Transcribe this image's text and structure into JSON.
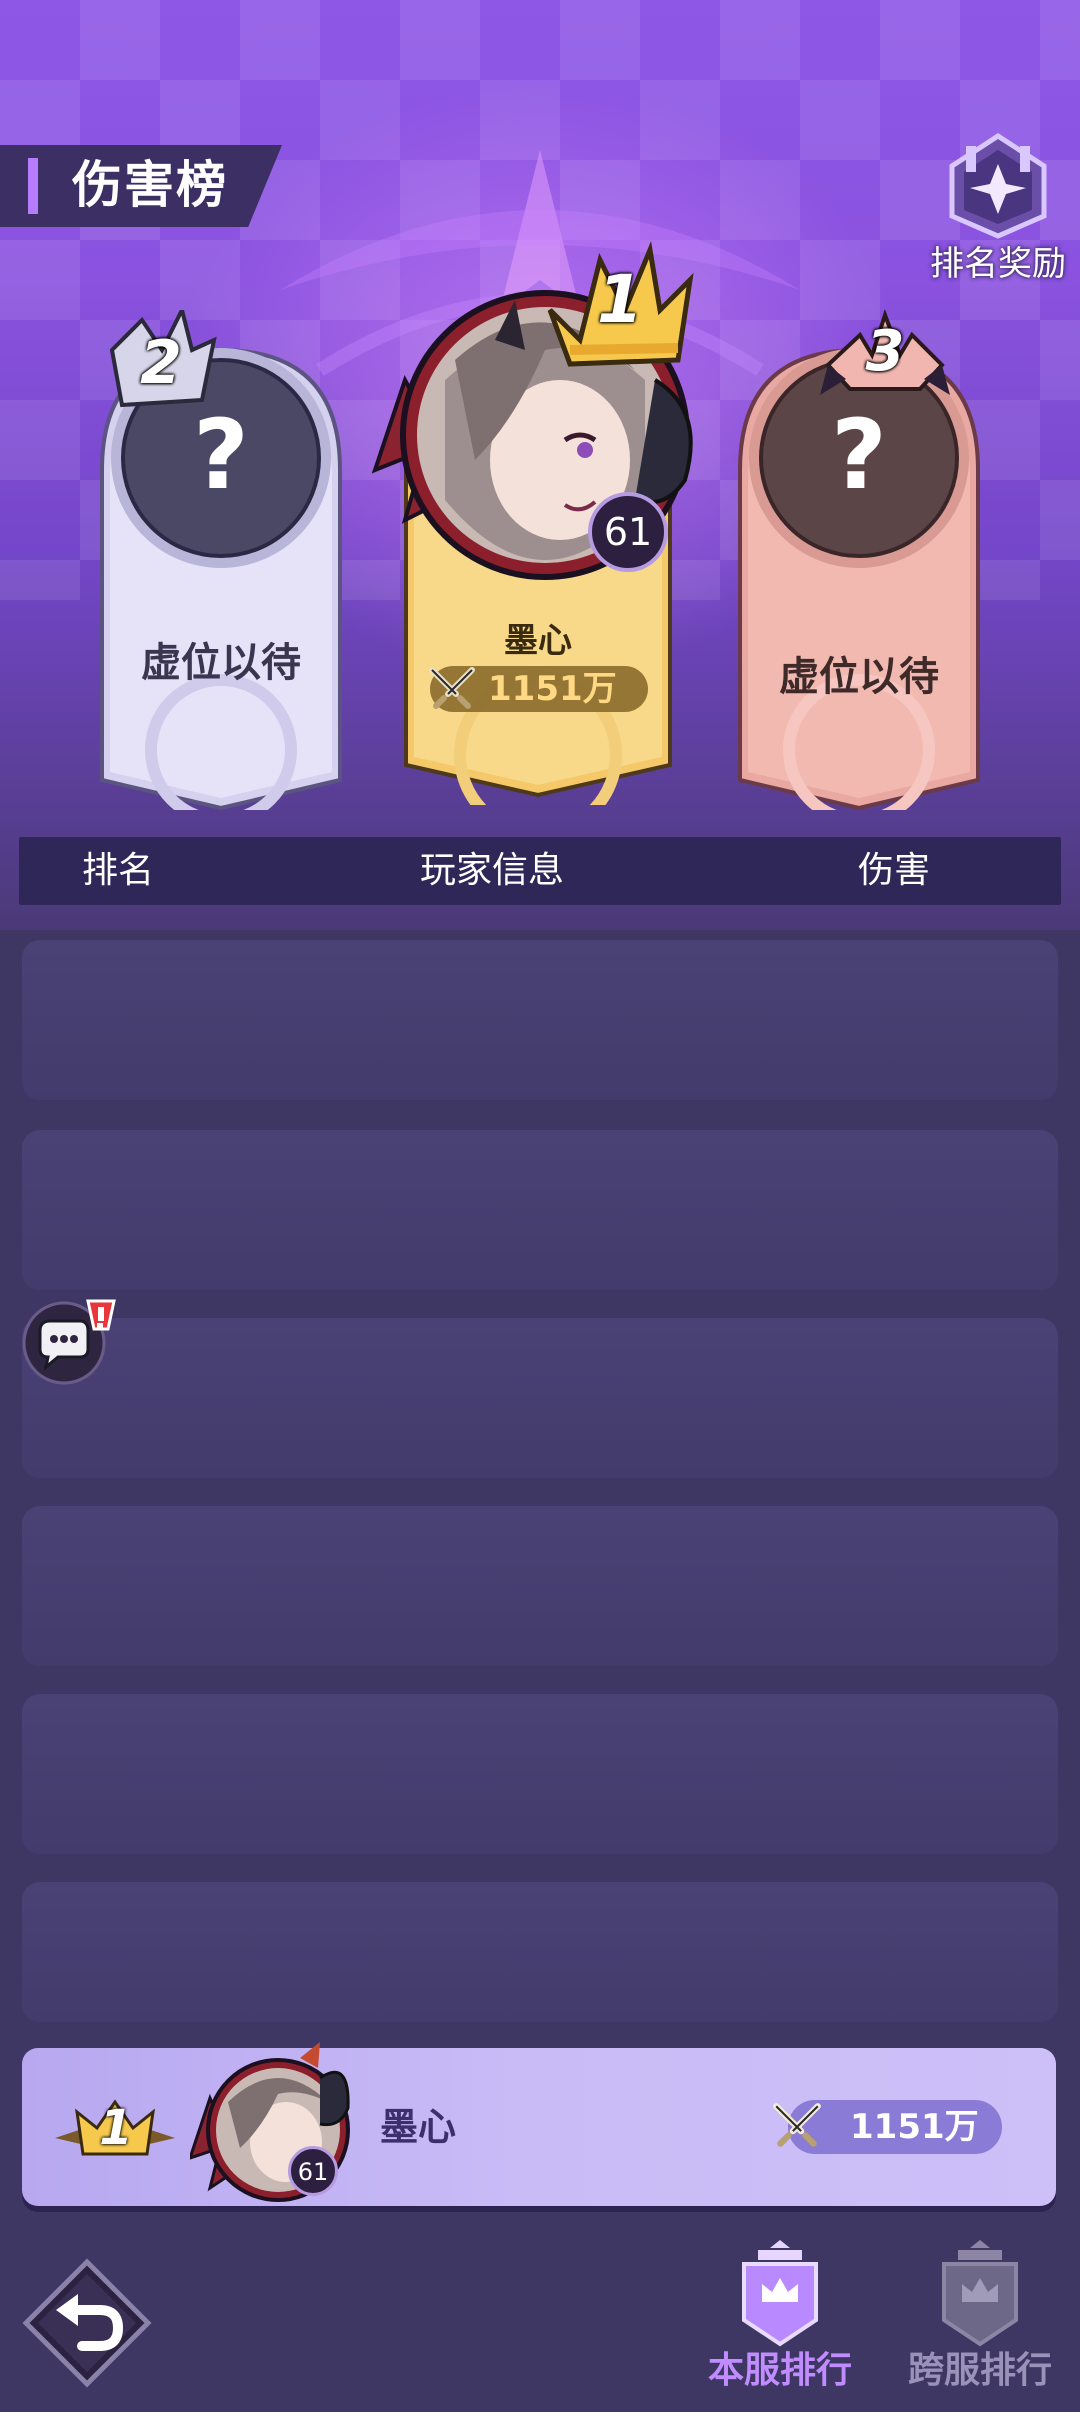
{
  "header": {
    "title": "伤害榜",
    "reward_button_label": "排名奖励"
  },
  "podium": {
    "first": {
      "rank": "1",
      "name": "墨心",
      "level": "61",
      "power": "1151万"
    },
    "second": {
      "rank": "2",
      "placeholder": "虚位以待",
      "icon": "question-mark"
    },
    "third": {
      "rank": "3",
      "placeholder": "虚位以待",
      "icon": "question-mark"
    }
  },
  "table": {
    "columns": [
      "排名",
      "玩家信息",
      "伤害"
    ],
    "rows": []
  },
  "my_rank": {
    "rank": "1",
    "name": "墨心",
    "level": "61",
    "power": "1151万"
  },
  "tabs": [
    {
      "label": "本服排行",
      "active": true
    },
    {
      "label": "跨服排行",
      "active": false
    }
  ],
  "colors": {
    "accent": "#b57cff",
    "active_tab": "#c08cff",
    "inactive_tab": "#9a92b8",
    "gold": "#ffd884"
  }
}
